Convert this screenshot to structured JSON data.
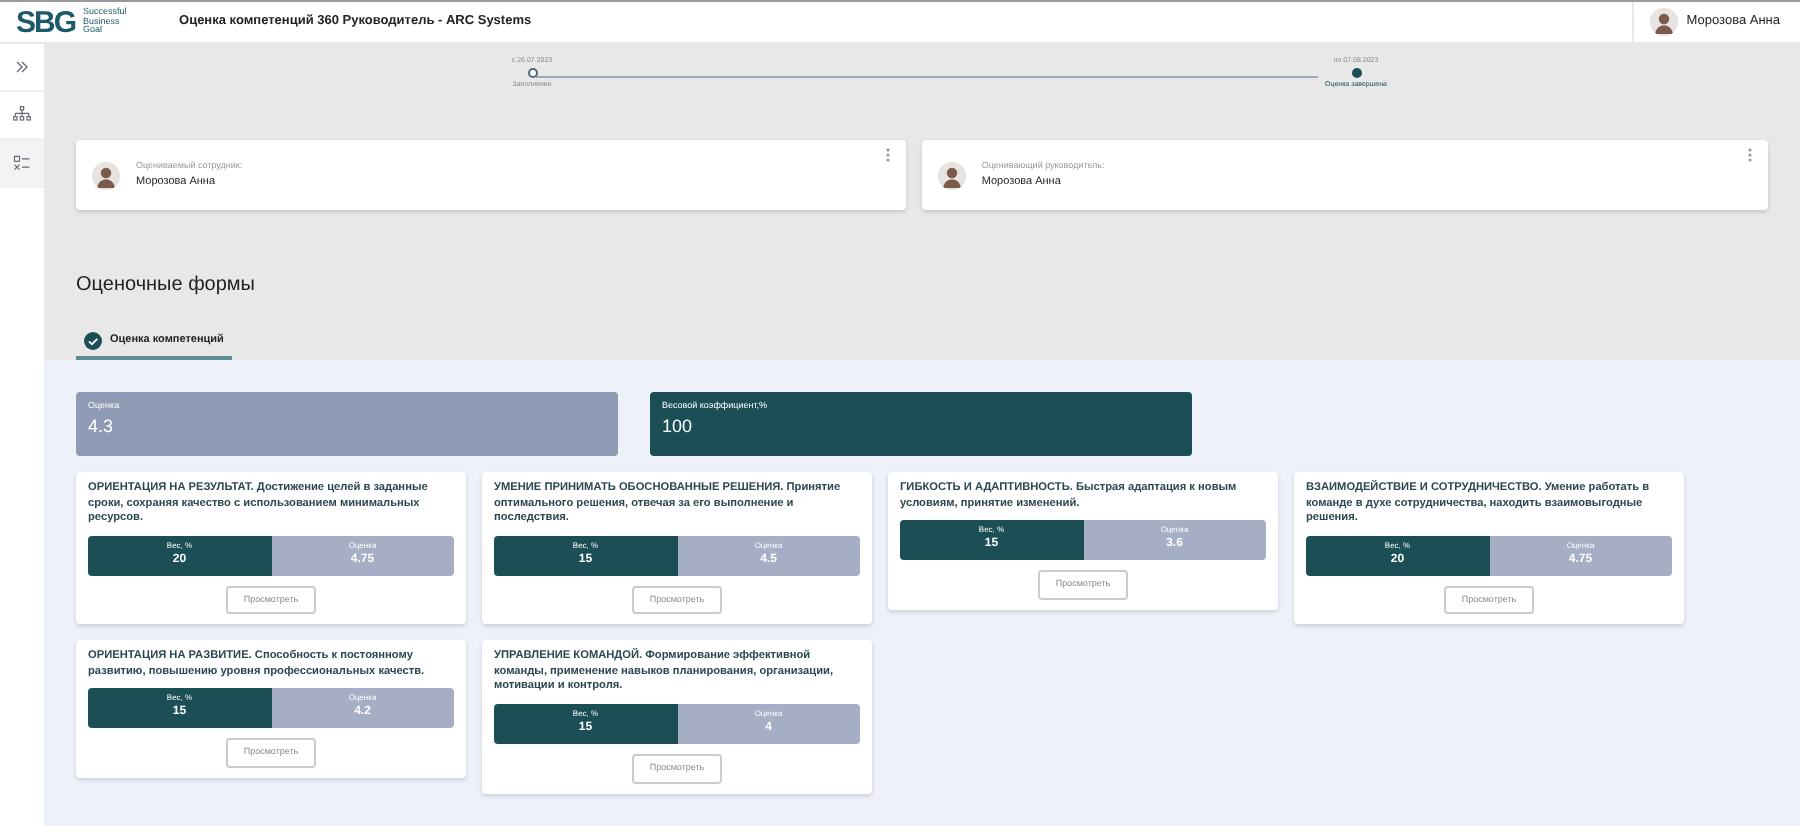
{
  "header": {
    "logo": "SBG",
    "logo_tagline": "Successful Business Goal",
    "title": "Оценка компетенций 360 Руководитель - ARC Systems",
    "user": "Морозова Анна"
  },
  "sidebar": {
    "items": [
      {
        "kind": "expand",
        "selected": false
      },
      {
        "kind": "hierarchy",
        "selected": false
      },
      {
        "kind": "checklist",
        "selected": true
      }
    ]
  },
  "timeline": [
    {
      "date": "с 26.07.2023",
      "label": "Заполнение",
      "selected": false
    },
    {
      "date": "по 07.08.2023",
      "label": "Оценка завершена",
      "selected": true
    }
  ],
  "people": [
    {
      "role": "Оцениваемый сотрудник:",
      "name": "Морозова Анна"
    },
    {
      "role": "Оценивающий руководитель:",
      "name": "Морозова Анна"
    }
  ],
  "section_title": "Оценочные формы",
  "tabs": [
    {
      "label": "Оценка компетенций",
      "selected": true
    }
  ],
  "summary": [
    {
      "kind": "score",
      "label": "Оценка",
      "value": "4.3"
    },
    {
      "kind": "weight",
      "label": "Весовой коэффициент,%",
      "value": "100"
    }
  ],
  "competencies": [
    {
      "title": "ОРИЕНТАЦИЯ НА РЕЗУЛЬТАТ. Достижение целей в заданные сроки, сохраняя качество с использованием минимальных ресурсов.",
      "weight_label": "Вес, %",
      "weight": "20",
      "score_label": "Оценка",
      "score": "4.75",
      "button": "Просмотреть"
    },
    {
      "title": "УМЕНИЕ ПРИНИМАТЬ ОБОСНОВАННЫЕ РЕШЕНИЯ. Принятие оптимального решения, отвечая за его выполнение и последствия.",
      "weight_label": "Вес, %",
      "weight": "15",
      "score_label": "Оценка",
      "score": "4.5",
      "button": "Просмотреть"
    },
    {
      "title": "ГИБКОСТЬ И АДАПТИВНОСТЬ. Быстрая адаптация к новым условиям, принятие изменений.",
      "weight_label": "Вес, %",
      "weight": "15",
      "score_label": "Оценка",
      "score": "3.6",
      "button": "Просмотреть"
    },
    {
      "title": "ВЗАИМОДЕЙСТВИЕ И СОТРУДНИЧЕСТВО. Умение работать в команде в духе сотрудничества, находить взаимовыгодные решения.",
      "weight_label": "Вес, %",
      "weight": "20",
      "score_label": "Оценка",
      "score": "4.75",
      "button": "Просмотреть"
    },
    {
      "title": "ОРИЕНТАЦИЯ НА РАЗВИТИЕ. Способность к постоянному развитию, повышению уровня профессиональных качеств.",
      "weight_label": "Вес, %",
      "weight": "15",
      "score_label": "Оценка",
      "score": "4.2",
      "button": "Просмотреть"
    },
    {
      "title": "УПРАВЛЕНИЕ КОМАНДОЙ. Формирование эффективной команды, применение навыков планирования, организации, мотивации и контроля.",
      "weight_label": "Вес, %",
      "weight": "15",
      "score_label": "Оценка",
      "score": "4",
      "button": "Просмотреть"
    }
  ]
}
